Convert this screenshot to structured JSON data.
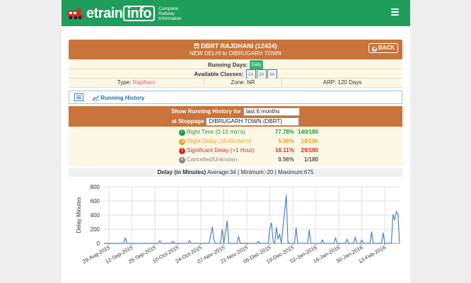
{
  "logo": {
    "brand_e": "e",
    "brand_train": "train",
    "brand_info": "info",
    "tagline_1": "Complete",
    "tagline_2": "Railway",
    "tagline_3": "Information"
  },
  "train": {
    "title": "DBRT RAJDHANI (12424)",
    "route": "NEW DELHI to DIBRUGARH TOWN",
    "back_label": "BACK"
  },
  "running_days": {
    "label": "Running Days:",
    "value": "Daily"
  },
  "classes": {
    "label": "Available Classes:",
    "items": [
      "1A",
      "2A",
      "3A"
    ]
  },
  "info": {
    "type_label": "Type:",
    "type_value": "Rajdhani",
    "zone": "Zone: NR",
    "arp": "ARP: 120 Days"
  },
  "running_history": {
    "link_label": "Running History"
  },
  "filter": {
    "show_label": "Show Running History for",
    "period_value": "last 6 months",
    "stoppage_label": "at Stoppage",
    "stoppage_value": "DIBRUGARH TOWN (DBRT)"
  },
  "stats": [
    {
      "label": "Right Time (0-15 min's)",
      "percent": "77.78%",
      "count": "140/180",
      "color": "#1a9e3a",
      "icon": "check-circle-icon"
    },
    {
      "label": "Slight Delay (15-60 min's)",
      "percent": "5.56%",
      "count": "10/180",
      "color": "#e7a223",
      "icon": "clock-circle-icon"
    },
    {
      "label": "Significant Delay (>1 Hour)",
      "percent": "16.11%",
      "count": "29/180",
      "color": "#d62b1f",
      "icon": "alert-circle-icon"
    },
    {
      "label": "Cancelled/Unknown",
      "percent": "0.56%",
      "count": "1/180",
      "color": "#888888",
      "icon": "cancel-circle-icon"
    }
  ],
  "delay_summary": {
    "label": "Delay (in Minutes)",
    "average": "Average:34",
    "minimum": "Minimum:-20",
    "maximum": "Maximum:675"
  },
  "chart_data": {
    "type": "line",
    "ylabel": "Delay Minutes",
    "ylim": [
      0,
      800
    ],
    "yticks": [
      0,
      200,
      400,
      600,
      800
    ],
    "grid": true,
    "series_color": "#4a84c4",
    "x_tick_labels": [
      "29-Aug-2015",
      "12-Sep-2015",
      "26-Sep-2015",
      "10-Oct-2015",
      "24-Oct-2015",
      "07-Nov-2015",
      "21-Nov-2015",
      "05-Dec-2015",
      "19-Dec-2015",
      "02-Jan-2016",
      "16-Jan-2016",
      "30-Jan-2016",
      "13-Feb-2016"
    ],
    "x_start": "2015-08-26",
    "x_end": "2016-02-22",
    "points": [
      [
        "2015-08-26",
        0
      ],
      [
        "2015-09-07",
        0
      ],
      [
        "2015-09-08",
        80
      ],
      [
        "2015-09-09",
        0
      ],
      [
        "2015-09-28",
        0
      ],
      [
        "2015-09-29",
        40
      ],
      [
        "2015-09-30",
        0
      ],
      [
        "2015-10-06",
        0
      ],
      [
        "2015-10-07",
        30
      ],
      [
        "2015-10-08",
        0
      ],
      [
        "2015-10-16",
        0
      ],
      [
        "2015-10-17",
        40
      ],
      [
        "2015-10-18",
        0
      ],
      [
        "2015-10-29",
        0
      ],
      [
        "2015-10-31",
        230
      ],
      [
        "2015-11-01",
        40
      ],
      [
        "2015-11-02",
        0
      ],
      [
        "2015-11-05",
        0
      ],
      [
        "2015-11-06",
        200
      ],
      [
        "2015-11-07",
        0
      ],
      [
        "2015-11-09",
        320
      ],
      [
        "2015-11-10",
        0
      ],
      [
        "2015-11-15",
        0
      ],
      [
        "2015-11-16",
        100
      ],
      [
        "2015-11-17",
        0
      ],
      [
        "2015-11-27",
        0
      ],
      [
        "2015-11-28",
        30
      ],
      [
        "2015-11-29",
        0
      ],
      [
        "2015-12-04",
        0
      ],
      [
        "2015-12-05",
        200
      ],
      [
        "2015-12-06",
        290
      ],
      [
        "2015-12-07",
        30
      ],
      [
        "2015-12-08",
        0
      ],
      [
        "2015-12-09",
        230
      ],
      [
        "2015-12-10",
        60
      ],
      [
        "2015-12-11",
        130
      ],
      [
        "2015-12-12",
        0
      ],
      [
        "2015-12-15",
        680
      ],
      [
        "2015-12-16",
        20
      ],
      [
        "2015-12-17",
        0
      ],
      [
        "2015-12-20",
        0
      ],
      [
        "2015-12-21",
        220
      ],
      [
        "2015-12-22",
        0
      ],
      [
        "2015-12-28",
        0
      ],
      [
        "2015-12-29",
        190
      ],
      [
        "2015-12-30",
        0
      ],
      [
        "2016-01-05",
        0
      ],
      [
        "2016-01-06",
        50
      ],
      [
        "2016-01-07",
        0
      ],
      [
        "2016-01-13",
        0
      ],
      [
        "2016-01-14",
        80
      ],
      [
        "2016-01-15",
        0
      ],
      [
        "2016-01-20",
        0
      ],
      [
        "2016-01-21",
        60
      ],
      [
        "2016-01-22",
        0
      ],
      [
        "2016-01-25",
        0
      ],
      [
        "2016-01-26",
        90
      ],
      [
        "2016-01-27",
        0
      ],
      [
        "2016-01-29",
        0
      ],
      [
        "2016-01-30",
        50
      ],
      [
        "2016-01-31",
        0
      ],
      [
        "2016-02-04",
        0
      ],
      [
        "2016-02-05",
        160
      ],
      [
        "2016-02-06",
        0
      ],
      [
        "2016-02-11",
        0
      ],
      [
        "2016-02-12",
        150
      ],
      [
        "2016-02-13",
        0
      ],
      [
        "2016-02-17",
        0
      ],
      [
        "2016-02-18",
        410
      ],
      [
        "2016-02-19",
        330
      ],
      [
        "2016-02-20",
        450
      ],
      [
        "2016-02-21",
        420
      ],
      [
        "2016-02-22",
        0
      ]
    ]
  }
}
